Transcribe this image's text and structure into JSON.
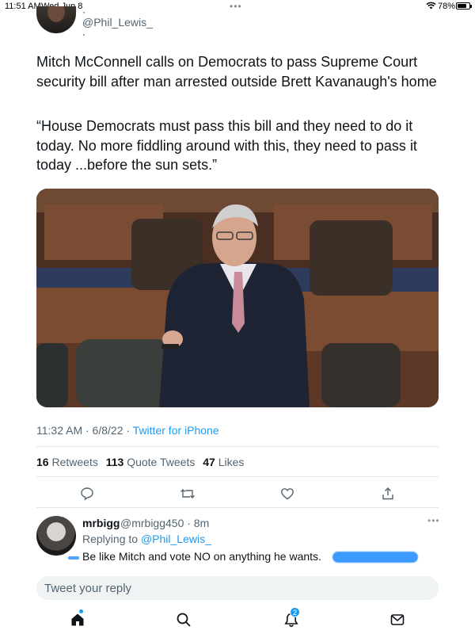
{
  "status_bar": {
    "time": "11:51 AM",
    "date": "Wed Jun 8",
    "battery_percent": "78%",
    "battery_level": 0.78
  },
  "tweet": {
    "author_handle": "@Phil_Lewis_",
    "paragraph_1": "Mitch McConnell calls on Democrats to pass Supreme Court security bill after man arrested outside Brett Kavanaugh's home",
    "paragraph_2": "“House Democrats must pass this bill  and they need to do it today. No more fiddling around with this, they need to pass it today ...before the sun sets.”",
    "timestamp": "11:32 AM · 6/8/22 · ",
    "source": "Twitter for iPhone",
    "stats": {
      "retweets_count": "16",
      "retweets_label": "Retweets",
      "quotes_count": "113",
      "quotes_label": "Quote Tweets",
      "likes_count": "47",
      "likes_label": "Likes"
    }
  },
  "actions": {
    "icons": [
      "reply-icon",
      "retweet-icon",
      "like-icon",
      "share-icon"
    ]
  },
  "reply": {
    "name": "mrbigg",
    "handle_time": "@mrbigg450 · 8m",
    "replying_to_label": "Replying to ",
    "replying_to_mention": "@Phil_Lewis_",
    "text": "Be like Mitch and vote NO on anything he wants."
  },
  "compose": {
    "placeholder": "Tweet your reply"
  },
  "tab_bar": {
    "notification_badge": "2",
    "icons": [
      "home-icon",
      "search-icon",
      "notifications-icon",
      "messages-icon"
    ]
  },
  "colors": {
    "accent": "#1d9bf0",
    "text_primary": "#0f1419",
    "text_secondary": "#536471"
  }
}
